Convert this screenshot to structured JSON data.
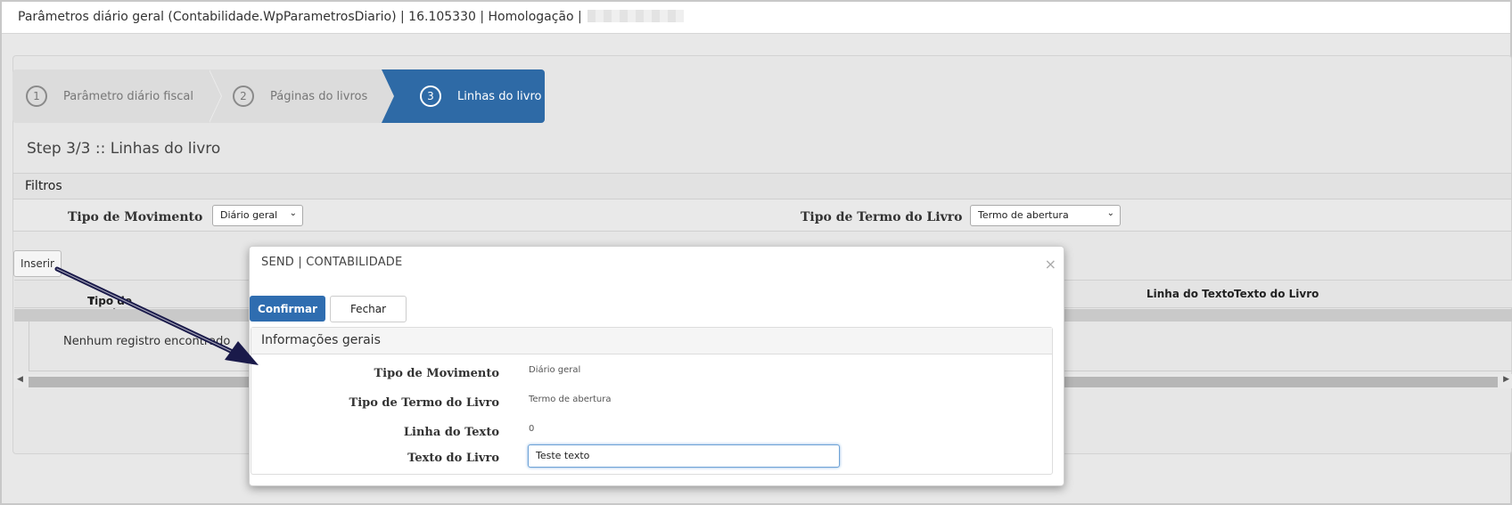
{
  "window": {
    "title": "Parâmetros diário geral (Contabilidade.WpParametrosDiario) | 16.105330 | Homologação |"
  },
  "wizard": {
    "steps": [
      {
        "number": "1",
        "label": "Parâmetro diário fiscal"
      },
      {
        "number": "2",
        "label": "Páginas do livros"
      },
      {
        "number": "3",
        "label": "Linhas do livro"
      }
    ],
    "active_step": 3,
    "step_title": "Step 3/3 :: Linhas do livro"
  },
  "filters": {
    "heading": "Filtros",
    "tipo_movimento_label": "Tipo de Movimento",
    "tipo_movimento_value": "Diário geral",
    "tipo_termo_label": "Tipo de Termo do Livro",
    "tipo_termo_value": "Termo de abertura"
  },
  "grid": {
    "insert_label": "Inserir",
    "columns": [
      "Tipo de Movimento",
      "Linha do Texto",
      "Texto do Livro"
    ],
    "sort_indicator": "↑",
    "empty_message": "Nenhum registro encontrado"
  },
  "modal": {
    "title": "SEND | CONTABILIDADE",
    "close_symbol": "×",
    "confirm_label": "Confirmar",
    "close_label": "Fechar",
    "section_heading": "Informações gerais",
    "fields": {
      "tipo_movimento_label": "Tipo de Movimento",
      "tipo_movimento_value": "Diário geral",
      "tipo_termo_label": "Tipo de Termo do Livro",
      "tipo_termo_value": "Termo de abertura",
      "linha_texto_label": "Linha do Texto",
      "linha_texto_value": "0",
      "texto_livro_label": "Texto do Livro",
      "texto_livro_value": "Teste texto"
    }
  },
  "colors": {
    "accent": "#2e6aa6",
    "confirm_button": "#2f6db0",
    "annotation_arrow": "#1a1a4a"
  }
}
